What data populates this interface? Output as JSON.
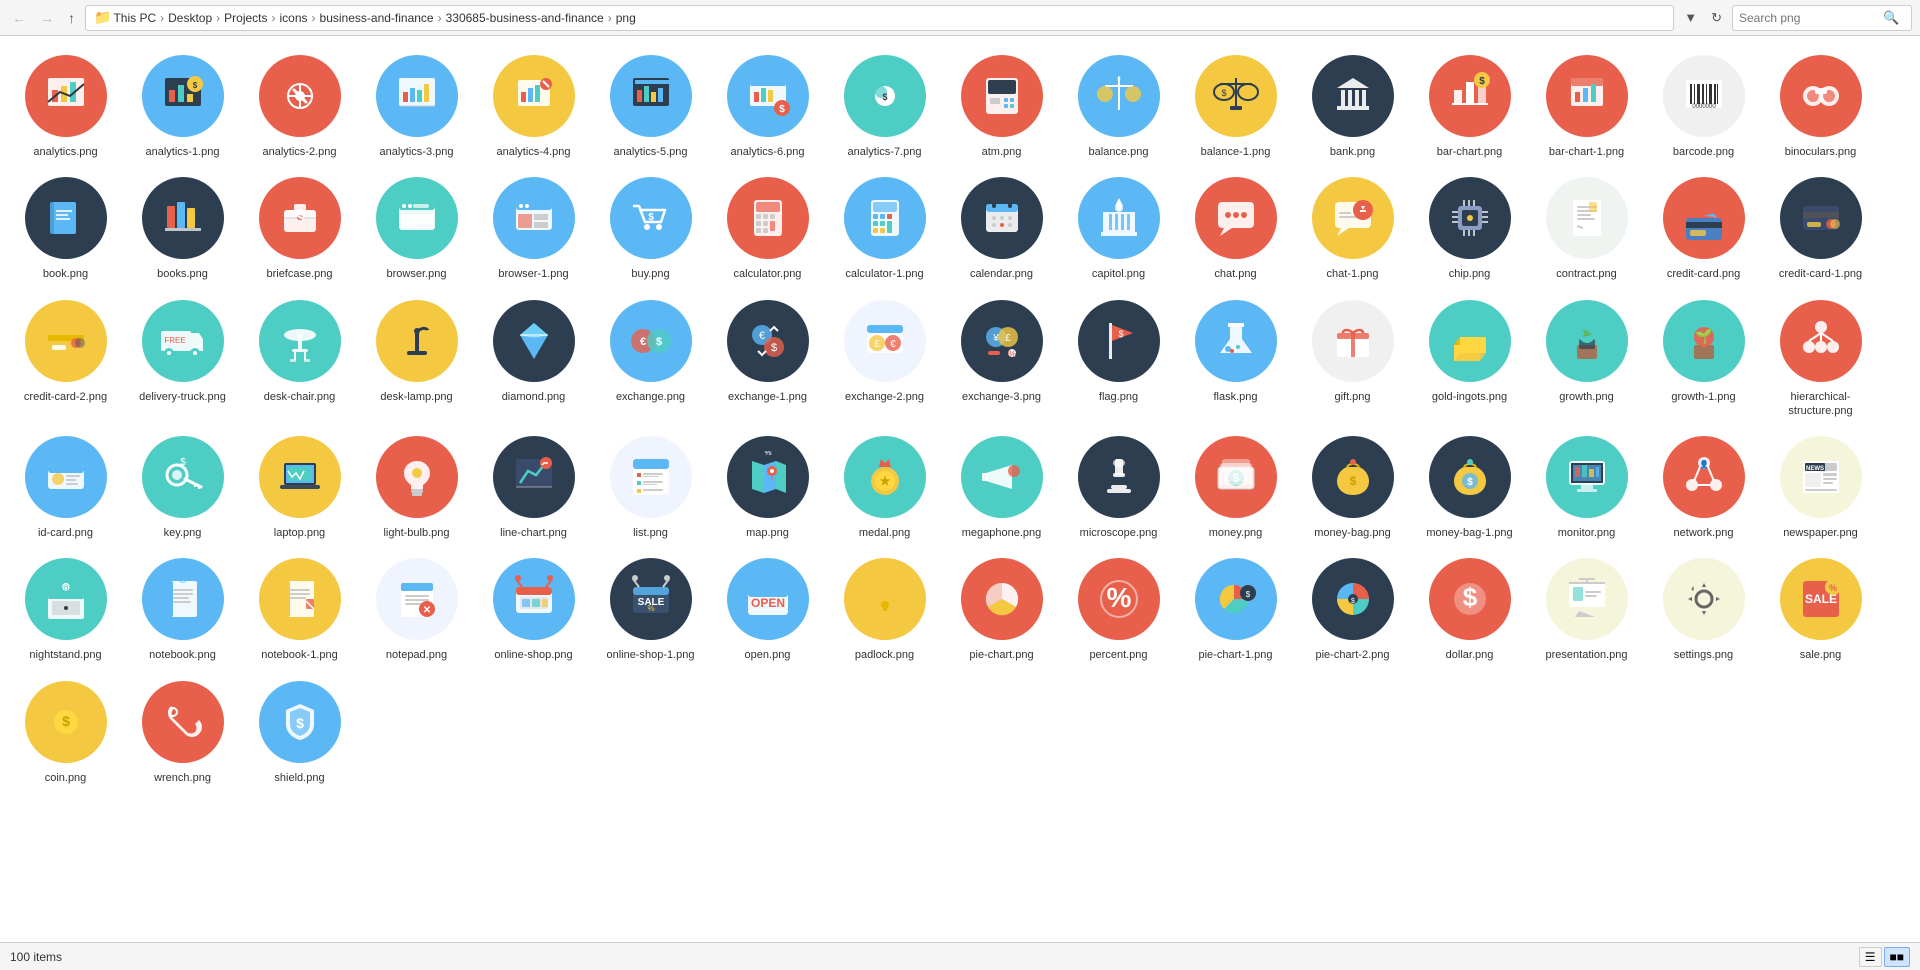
{
  "addressBar": {
    "path": "This PC > Desktop > Projects > icons > business-and-finance > 330685-business-and-finance > png",
    "pathParts": [
      "This PC",
      "Desktop",
      "Projects",
      "icons",
      "business-and-finance",
      "330685-business-and-finance",
      "png"
    ],
    "search": {
      "placeholder": "Search png",
      "value": ""
    },
    "refreshTitle": "Refresh",
    "dropdownTitle": "Recent locations"
  },
  "statusBar": {
    "itemCount": "100 items",
    "viewGrid": "Grid view",
    "viewList": "List view"
  },
  "files": [
    {
      "name": "analytics.png",
      "bg": "#e8604c",
      "style": "analytics"
    },
    {
      "name": "analytics-1.png",
      "bg": "#5bb8f5",
      "style": "analytics-1"
    },
    {
      "name": "analytics-2.png",
      "bg": "#e8604c",
      "style": "analytics-2"
    },
    {
      "name": "analytics-3.png",
      "bg": "#5bb8f5",
      "style": "analytics-3"
    },
    {
      "name": "analytics-4.png",
      "bg": "#f5c842",
      "style": "analytics-4"
    },
    {
      "name": "analytics-5.png",
      "bg": "#5bb8f5",
      "style": "analytics-5"
    },
    {
      "name": "analytics-6.png",
      "bg": "#5bb8f5",
      "style": "analytics-6"
    },
    {
      "name": "analytics-7.png",
      "bg": "#4ecdc4",
      "style": "analytics-7"
    },
    {
      "name": "atm.png",
      "bg": "#e8604c",
      "style": "atm"
    },
    {
      "name": "balance.png",
      "bg": "#5bb8f5",
      "style": "balance"
    },
    {
      "name": "balance-1.png",
      "bg": "#f5c842",
      "style": "balance-1"
    },
    {
      "name": "bank.png",
      "bg": "#2c3e50",
      "style": "bank"
    },
    {
      "name": "bar-chart.png",
      "bg": "#e8604c",
      "style": "bar-chart"
    },
    {
      "name": "bar-chart-1.png",
      "bg": "#e8604c",
      "style": "bar-chart-1"
    },
    {
      "name": "barcode.png",
      "bg": "#f0f0f0",
      "style": "barcode"
    },
    {
      "name": "binoculars.png",
      "bg": "#e8604c",
      "style": "binoculars"
    },
    {
      "name": "book.png",
      "bg": "#2c3e50",
      "style": "book"
    },
    {
      "name": "books.png",
      "bg": "#2c3e50",
      "style": "books"
    },
    {
      "name": "briefcase.png",
      "bg": "#e8604c",
      "style": "briefcase"
    },
    {
      "name": "browser.png",
      "bg": "#4ecdc4",
      "style": "browser"
    },
    {
      "name": "browser-1.png",
      "bg": "#5bb8f5",
      "style": "browser-1"
    },
    {
      "name": "buy.png",
      "bg": "#5bb8f5",
      "style": "buy"
    },
    {
      "name": "calculator.png",
      "bg": "#e8604c",
      "style": "calculator"
    },
    {
      "name": "calculator-1.png",
      "bg": "#5bb8f5",
      "style": "calculator-1"
    },
    {
      "name": "calendar.png",
      "bg": "#2c3e50",
      "style": "calendar"
    },
    {
      "name": "capitol.png",
      "bg": "#5bb8f5",
      "style": "capitol"
    },
    {
      "name": "chat.png",
      "bg": "#e8604c",
      "style": "chat"
    },
    {
      "name": "chat-1.png",
      "bg": "#f5c842",
      "style": "chat-1"
    },
    {
      "name": "chip.png",
      "bg": "#2c3e50",
      "style": "chip"
    },
    {
      "name": "contract.png",
      "bg": "#f0f4f0",
      "style": "contract"
    },
    {
      "name": "credit-card.png",
      "bg": "#e8604c",
      "style": "credit-card"
    },
    {
      "name": "credit-card-1.png",
      "bg": "#2c3e50",
      "style": "credit-card-1"
    },
    {
      "name": "credit-card-2.png",
      "bg": "#f5c842",
      "style": "credit-card-2"
    },
    {
      "name": "delivery-truck.png",
      "bg": "#4ecdc4",
      "style": "delivery-truck"
    },
    {
      "name": "desk-chair.png",
      "bg": "#4ecdc4",
      "style": "desk-chair"
    },
    {
      "name": "desk-lamp.png",
      "bg": "#f5c842",
      "style": "desk-lamp"
    },
    {
      "name": "diamond.png",
      "bg": "#2c3e50",
      "style": "diamond"
    },
    {
      "name": "exchange.png",
      "bg": "#5bb8f5",
      "style": "exchange"
    },
    {
      "name": "exchange-1.png",
      "bg": "#2c3e50",
      "style": "exchange-1"
    },
    {
      "name": "exchange-2.png",
      "bg": "#f0f4ff",
      "style": "exchange-2"
    },
    {
      "name": "exchange-3.png",
      "bg": "#2c3e50",
      "style": "exchange-3"
    },
    {
      "name": "flag.png",
      "bg": "#2c3e50",
      "style": "flag"
    },
    {
      "name": "flask.png",
      "bg": "#5bb8f5",
      "style": "flask"
    },
    {
      "name": "gift.png",
      "bg": "#f0f0f0",
      "style": "gift"
    },
    {
      "name": "gold-ingots.png",
      "bg": "#4ecdc4",
      "style": "gold-ingots"
    },
    {
      "name": "growth.png",
      "bg": "#4ecdc4",
      "style": "growth"
    },
    {
      "name": "growth-1.png",
      "bg": "#4ecdc4",
      "style": "growth-1"
    },
    {
      "name": "hierarchical-structure.png",
      "bg": "#e8604c",
      "style": "hierarchical"
    },
    {
      "name": "id-card.png",
      "bg": "#5bb8f5",
      "style": "id-card"
    },
    {
      "name": "key.png",
      "bg": "#4ecdc4",
      "style": "key"
    },
    {
      "name": "laptop.png",
      "bg": "#f5c842",
      "style": "laptop"
    },
    {
      "name": "light-bulb.png",
      "bg": "#e8604c",
      "style": "light-bulb"
    },
    {
      "name": "line-chart.png",
      "bg": "#2c3e50",
      "style": "line-chart"
    },
    {
      "name": "list.png",
      "bg": "#f0f4ff",
      "style": "list"
    },
    {
      "name": "map.png",
      "bg": "#2c3e50",
      "style": "map"
    },
    {
      "name": "medal.png",
      "bg": "#4ecdc4",
      "style": "medal"
    },
    {
      "name": "megaphone.png",
      "bg": "#4ecdc4",
      "style": "megaphone"
    },
    {
      "name": "microscope.png",
      "bg": "#2c3e50",
      "style": "microscope"
    },
    {
      "name": "money.png",
      "bg": "#e8604c",
      "style": "money"
    },
    {
      "name": "money-bag.png",
      "bg": "#2c3e50",
      "style": "money-bag"
    },
    {
      "name": "money-bag-1.png",
      "bg": "#2c3e50",
      "style": "money-bag-1"
    },
    {
      "name": "monitor.png",
      "bg": "#4ecdc4",
      "style": "monitor"
    },
    {
      "name": "network.png",
      "bg": "#e8604c",
      "style": "network"
    },
    {
      "name": "newspaper.png",
      "bg": "#f5f5dc",
      "style": "newspaper"
    },
    {
      "name": "nightstand.png",
      "bg": "#4ecdc4",
      "style": "nightstand"
    },
    {
      "name": "notebook.png",
      "bg": "#5bb8f5",
      "style": "notebook"
    },
    {
      "name": "notebook-1.png",
      "bg": "#f5c842",
      "style": "notebook-1"
    },
    {
      "name": "notepad.png",
      "bg": "#f0f4ff",
      "style": "notepad"
    },
    {
      "name": "online-shop.png",
      "bg": "#5bb8f5",
      "style": "online-shop"
    },
    {
      "name": "online-shop-1.png",
      "bg": "#2c3e50",
      "style": "online-shop-1"
    },
    {
      "name": "open.png",
      "bg": "#5bb8f5",
      "style": "open"
    },
    {
      "name": "padlock.png",
      "bg": "#f5c842",
      "style": "padlock"
    },
    {
      "name": "pie-chart.png",
      "bg": "#e8604c",
      "style": "pie-chart"
    },
    {
      "name": "percent.png",
      "bg": "#e8604c",
      "style": "percent"
    },
    {
      "name": "pie-chart-1.png",
      "bg": "#5bb8f5",
      "style": "pie-chart-1"
    },
    {
      "name": "pie-chart-2.png",
      "bg": "#2c3e50",
      "style": "pie-chart-2"
    },
    {
      "name": "dollar.png",
      "bg": "#e8604c",
      "style": "dollar"
    },
    {
      "name": "presentation.png",
      "bg": "#f5f5dc",
      "style": "presentation"
    },
    {
      "name": "settings.png",
      "bg": "#f5f5dc",
      "style": "settings"
    },
    {
      "name": "sale.png",
      "bg": "#f5c842",
      "style": "sale"
    },
    {
      "name": "coin.png",
      "bg": "#f5c842",
      "style": "coin"
    },
    {
      "name": "wrench.png",
      "bg": "#e8604c",
      "style": "wrench"
    },
    {
      "name": "shield.png",
      "bg": "#5bb8f5",
      "style": "shield"
    }
  ]
}
